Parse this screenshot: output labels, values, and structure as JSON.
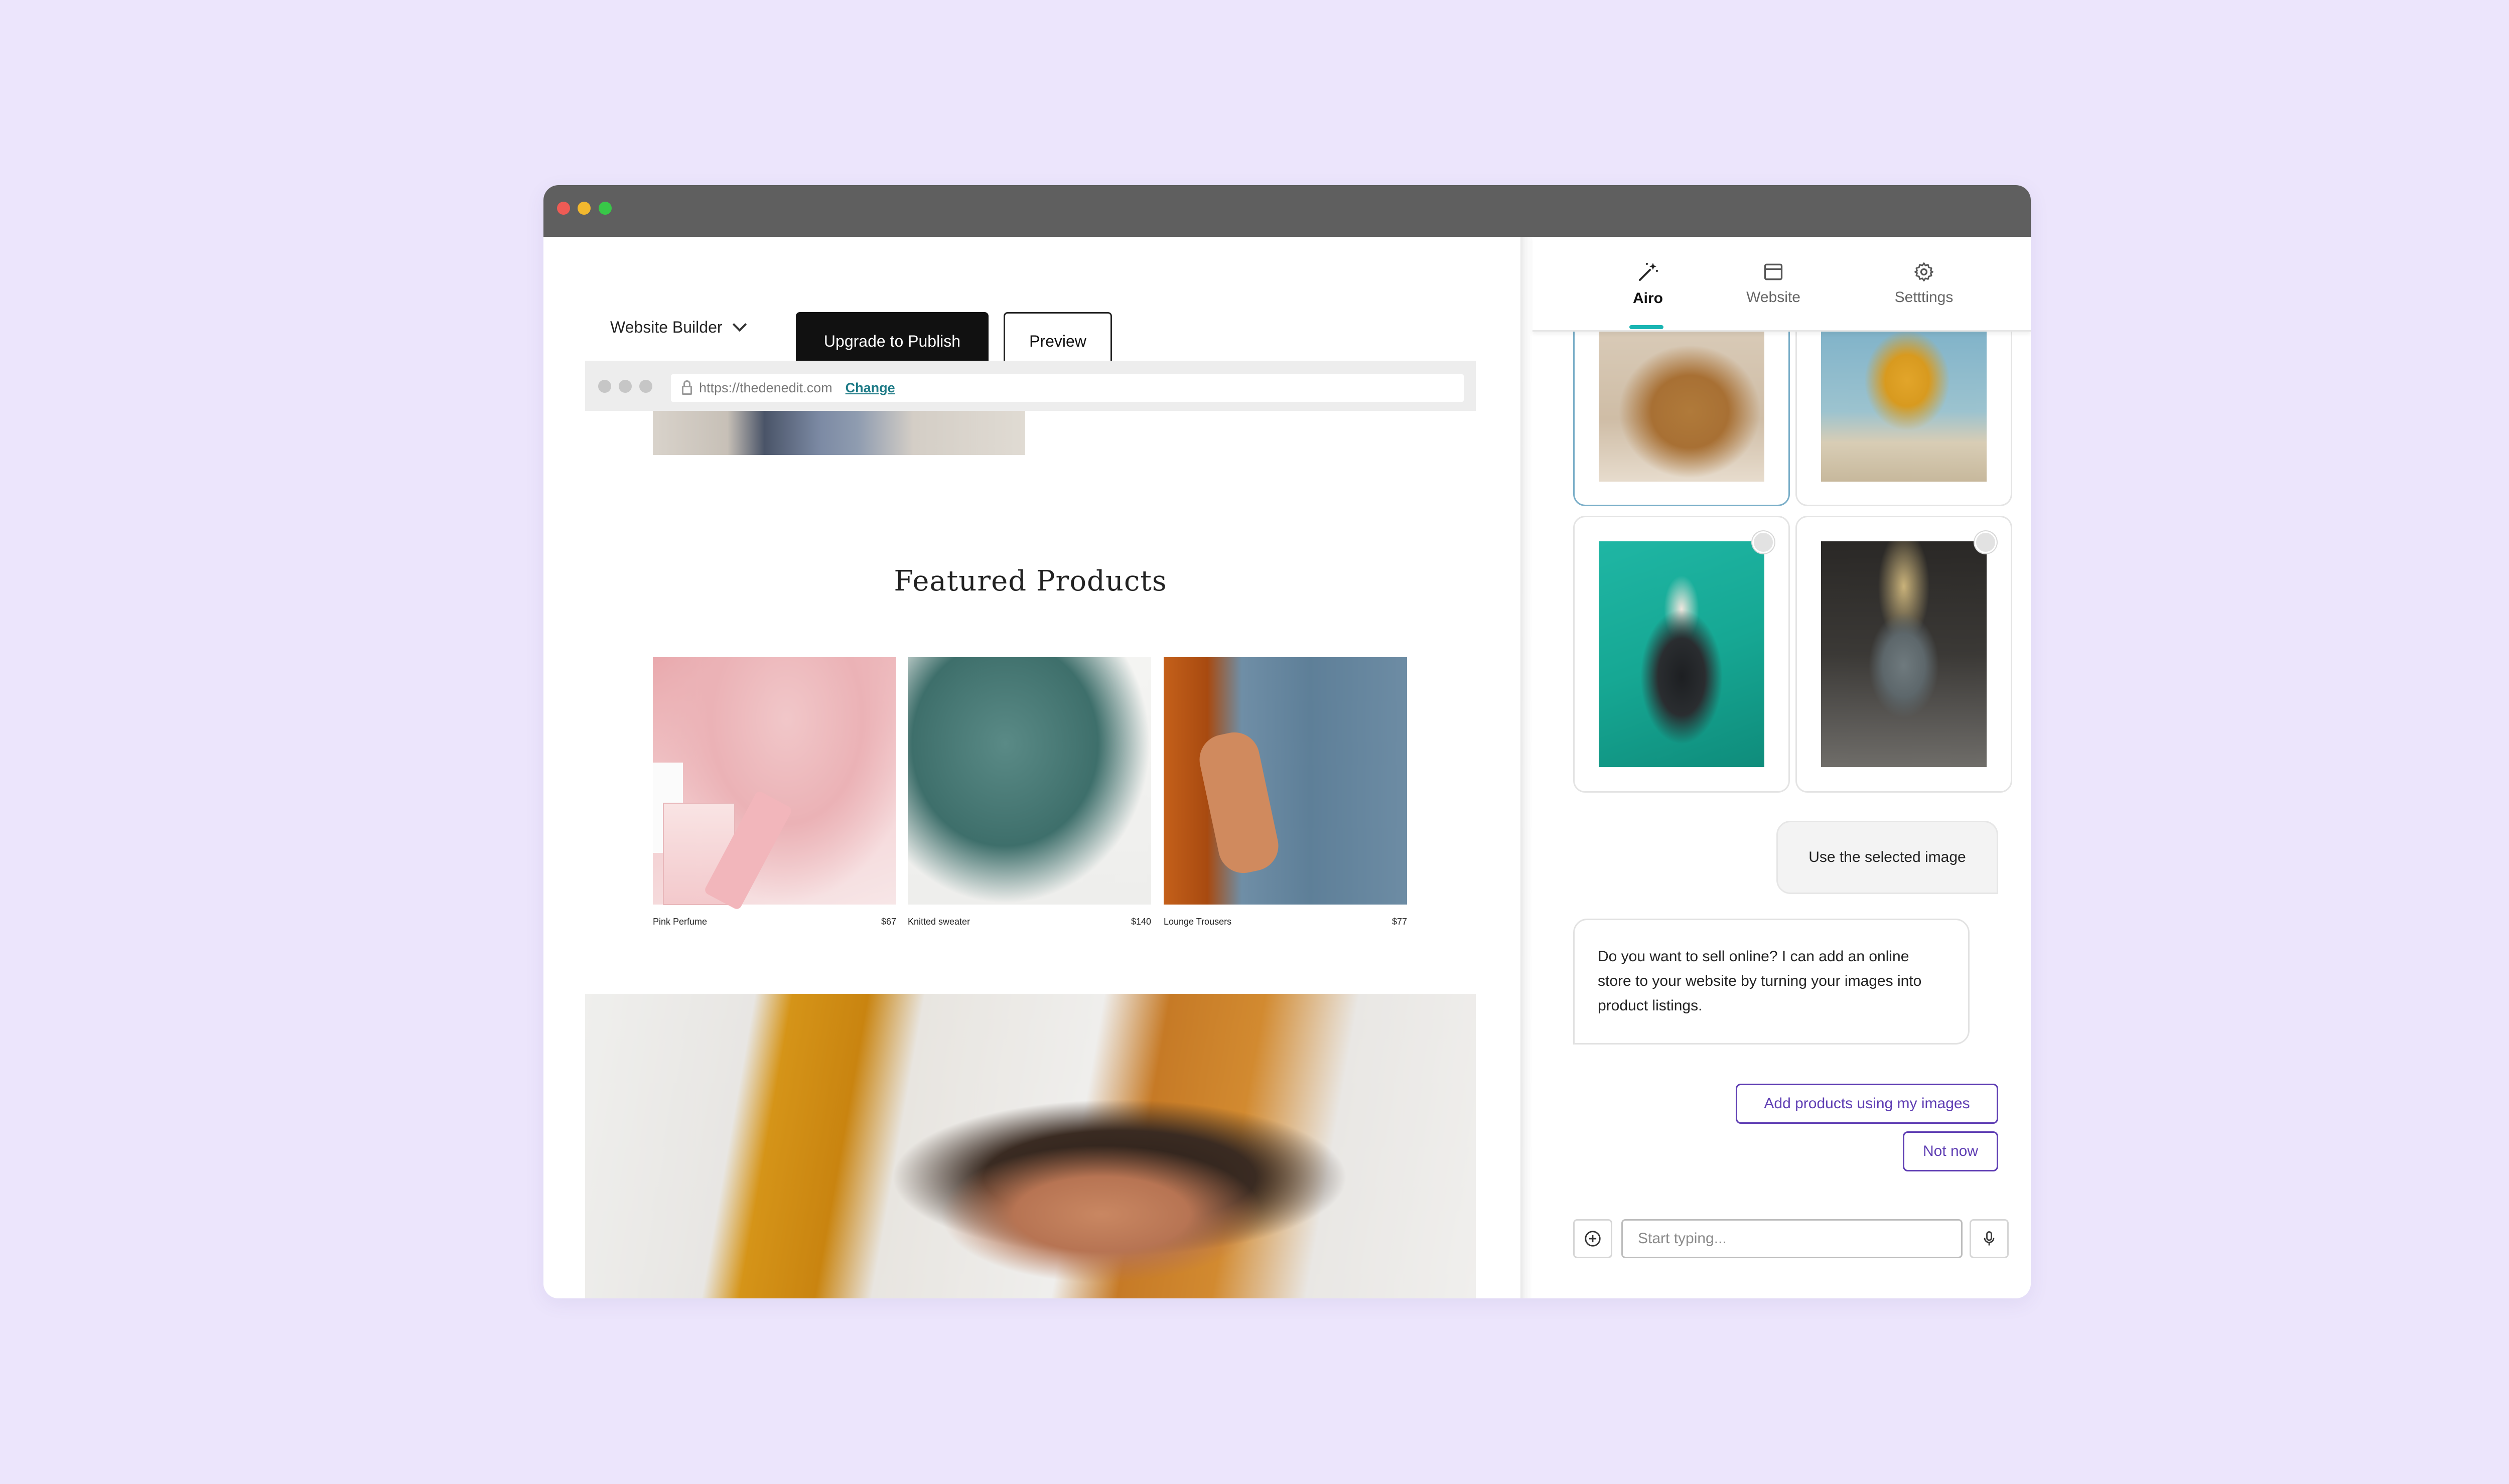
{
  "window": {
    "controls": [
      "close",
      "minimize",
      "maximize"
    ],
    "colors": {
      "close": "#ee5b55",
      "minimize": "#f2b82e",
      "maximize": "#38c748",
      "titlebar": "#5f5f5f"
    }
  },
  "toolbar": {
    "builder_label": "Website Builder",
    "upgrade_label": "Upgrade to Publish",
    "preview_label": "Preview"
  },
  "browser": {
    "url": "https://thedenedit.com",
    "change_label": "Change"
  },
  "site": {
    "featured_title": "Featured Products",
    "products": [
      {
        "name": "Pink Perfume",
        "price": "$67"
      },
      {
        "name": "Knitted sweater",
        "price": "$140"
      },
      {
        "name": "Lounge Trousers",
        "price": "$77"
      }
    ]
  },
  "panel": {
    "tabs": [
      {
        "label": "Airo",
        "icon": "magic-wand-icon",
        "active": true
      },
      {
        "label": "Website",
        "icon": "browser-window-icon",
        "active": false
      },
      {
        "label": "Setttings",
        "icon": "gear-icon",
        "active": false
      }
    ],
    "accent_color": "#1ab5b3",
    "user_message": "Use the selected image",
    "bot_message": "Do you want to sell online? I can add an online store to your website by turning your images into product listings.",
    "suggestions": {
      "add_products": "Add products using my images",
      "not_now": "Not now"
    },
    "suggestion_color": "#5e3db3",
    "input_placeholder": "Start typing..."
  }
}
